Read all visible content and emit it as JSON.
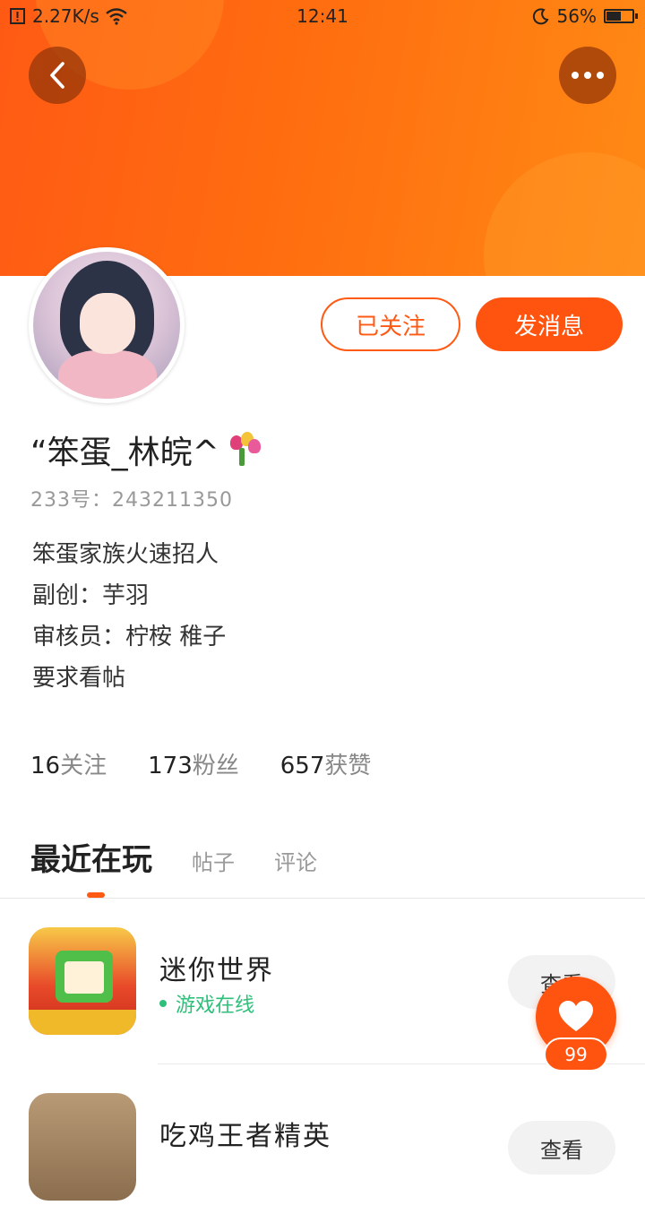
{
  "status_bar": {
    "net_speed": "2.27K/s",
    "time": "12:41",
    "battery": "56%",
    "battery_level": 0.56
  },
  "header": {
    "back_icon": "chevron-left-icon",
    "more_icon": "more-dots-icon",
    "accent_color": "#ff5a14"
  },
  "profile": {
    "nickname": "“笨蛋_林皖^",
    "id_line": "233号：243211350",
    "bio": [
      "笨蛋家族火速招人",
      "副创：芋羽",
      "审核员：柠桉  稚子",
      "要求看帖"
    ],
    "followed_label": "已关注",
    "message_label": "发消息"
  },
  "stats": [
    {
      "num": "16",
      "label": "关注"
    },
    {
      "num": "173",
      "label": "粉丝"
    },
    {
      "num": "657",
      "label": "获赞"
    }
  ],
  "tabs": {
    "active": "最近在玩",
    "posts": "帖子",
    "comments": "评论"
  },
  "games": [
    {
      "name": "迷你世界",
      "status": "游戏在线",
      "button": "查看"
    },
    {
      "name": "吃鸡王者精英",
      "button": "查看"
    }
  ],
  "like": {
    "count": "99",
    "icon": "heart-icon"
  }
}
